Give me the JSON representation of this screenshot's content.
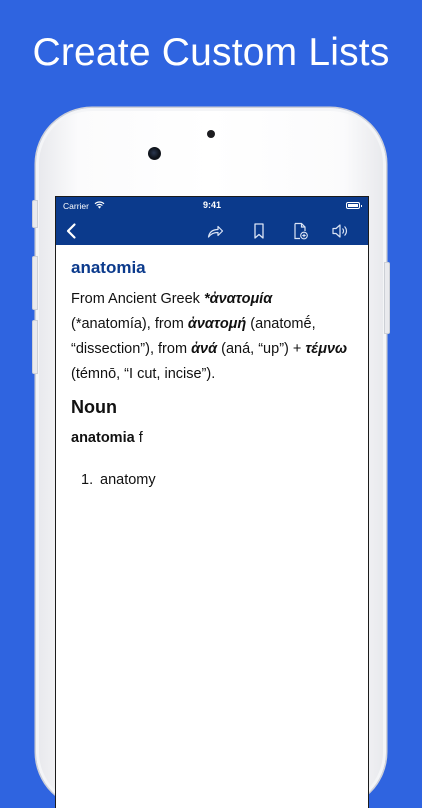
{
  "headline": "Create Custom Lists",
  "status_bar": {
    "carrier": "Carrier",
    "time": "9:41"
  },
  "nav_icons": [
    "back-chevron-icon",
    "share-icon",
    "bookmark-icon",
    "add-document-icon",
    "speaker-icon"
  ],
  "colors": {
    "background": "#2f64e0",
    "nav_bar": "#0b3a8c",
    "headword": "#0b3a8c",
    "text": "#111111"
  },
  "entry": {
    "word": "anatomia",
    "etymology": {
      "p1": "From Ancient Greek ",
      "g1": "*ἀνατομία",
      "p2": " (*anatomía), from ",
      "g2": "ἀνατομή",
      "p3": " (anatomḗ, “dissection”), from ",
      "g3": "ἀνά",
      "p4": " (aná, “up”) + ",
      "g4": "τέμνω",
      "p5": " (témnō, “I cut, incise”)."
    },
    "part_of_speech": "Noun",
    "headword": "anatomia",
    "gender": " f",
    "senses": [
      {
        "number": "1.",
        "text": "anatomy"
      }
    ]
  }
}
